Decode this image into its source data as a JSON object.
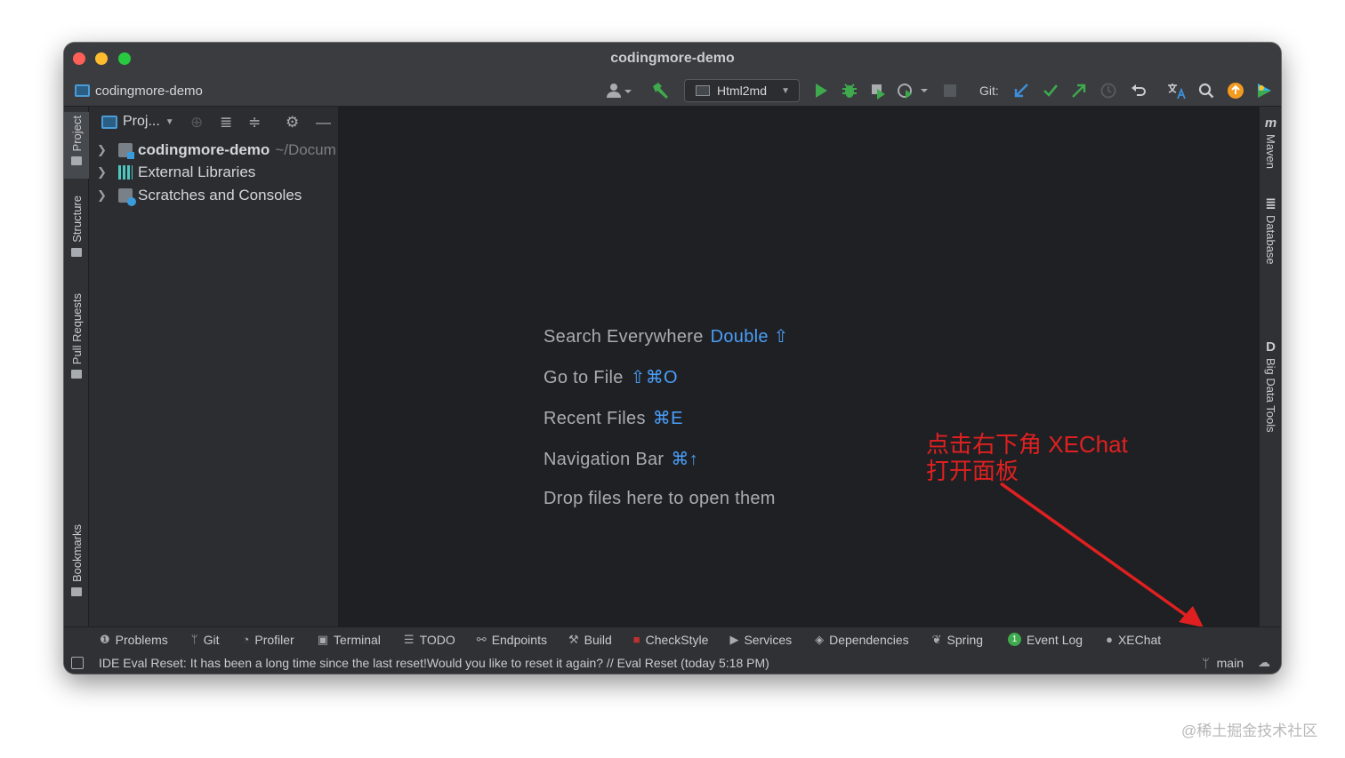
{
  "window": {
    "title": "codingmore-demo"
  },
  "navbar": {
    "project_crumb": "codingmore-demo",
    "run_config": "Html2md",
    "git_label": "Git:"
  },
  "left_tabs": [
    "Project",
    "Structure",
    "Pull Requests",
    "Bookmarks"
  ],
  "project_panel": {
    "title": "Proj...",
    "tree": [
      {
        "name": "codingmore-demo",
        "path": "~/Docum"
      },
      {
        "name": "External Libraries"
      },
      {
        "name": "Scratches and Consoles"
      }
    ]
  },
  "editor": {
    "hints": [
      {
        "label": "Search Everywhere",
        "shortcut": "Double ⇧"
      },
      {
        "label": "Go to File",
        "shortcut": "⇧⌘O"
      },
      {
        "label": "Recent Files",
        "shortcut": "⌘E"
      },
      {
        "label": "Navigation Bar",
        "shortcut": "⌘↑"
      },
      {
        "label": "Drop files here to open them",
        "shortcut": ""
      }
    ],
    "annotation_line1": "点击右下角 XEChat",
    "annotation_line2": "打开面板"
  },
  "right_tabs": [
    "Maven",
    "Database",
    "Big Data Tools"
  ],
  "tool_windows": [
    {
      "label": "Problems",
      "icon": "info-icon"
    },
    {
      "label": "Git",
      "icon": "branch-icon"
    },
    {
      "label": "Profiler",
      "icon": "profiler-icon"
    },
    {
      "label": "Terminal",
      "icon": "terminal-icon"
    },
    {
      "label": "TODO",
      "icon": "list-icon"
    },
    {
      "label": "Endpoints",
      "icon": "endpoints-icon"
    },
    {
      "label": "Build",
      "icon": "hammer-icon"
    },
    {
      "label": "CheckStyle",
      "icon": "checkstyle-icon"
    },
    {
      "label": "Services",
      "icon": "play-icon"
    },
    {
      "label": "Dependencies",
      "icon": "layers-icon"
    },
    {
      "label": "Spring",
      "icon": "leaf-icon"
    },
    {
      "label": "Event Log",
      "icon": "badge-icon",
      "badge": "1"
    },
    {
      "label": "XEChat",
      "icon": "chat-icon"
    }
  ],
  "status": {
    "message": "IDE Eval Reset: It has been a long time since the last reset!Would you like to reset it again? // Eval Reset (today 5:18 PM)",
    "branch": "main"
  },
  "watermark": "@稀土掘金技术社区",
  "colors": {
    "accent": "#4a9ef8",
    "annotation": "#e02020",
    "run": "#3ea94d"
  }
}
